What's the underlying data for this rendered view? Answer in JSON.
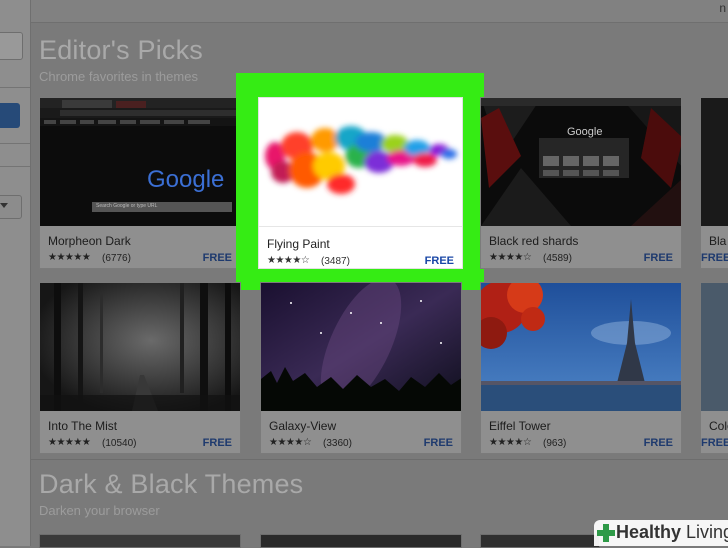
{
  "top_right_text": "n",
  "sections": {
    "editors": {
      "title": "Editor's Picks",
      "subtitle": "Chrome favorites in themes"
    },
    "dark": {
      "title": "Dark & Black Themes",
      "subtitle": "Darken your browser"
    }
  },
  "cards": {
    "morpheon": {
      "name": "Morpheon Dark",
      "stars": "★★★★★",
      "count": "(6776)",
      "price": "FREE",
      "thumb_logo": "Google",
      "thumb_search": "Search Google or type URL"
    },
    "flying": {
      "name": "Flying Paint",
      "stars": "★★★★☆",
      "count": "(3487)",
      "price": "FREE"
    },
    "blackred": {
      "name": "Black red shards",
      "stars": "★★★★☆",
      "count": "(4589)",
      "price": "FREE",
      "thumb_logo": "Google"
    },
    "edge1": {
      "name": "Bla",
      "price": "FREE"
    },
    "mist": {
      "name": "Into The Mist",
      "stars": "★★★★★",
      "count": "(10540)",
      "price": "FREE"
    },
    "galaxy": {
      "name": "Galaxy-View",
      "stars": "★★★★☆",
      "count": "(3360)",
      "price": "FREE"
    },
    "eiffel": {
      "name": "Eiffel Tower",
      "stars": "★★★★☆",
      "count": "(963)",
      "price": "FREE"
    },
    "edge2": {
      "name": "Colo",
      "price": "FREE"
    }
  },
  "watermark": {
    "brand_bold": "Healthy",
    "brand_light": " Living"
  },
  "colors": {
    "highlight": "#35ec14",
    "price_link": "#1a47a6",
    "overlay_bg": "#7a7a7a"
  },
  "icons": [
    "star-icon",
    "dropdown-arrow-icon",
    "cross-logo-icon"
  ]
}
